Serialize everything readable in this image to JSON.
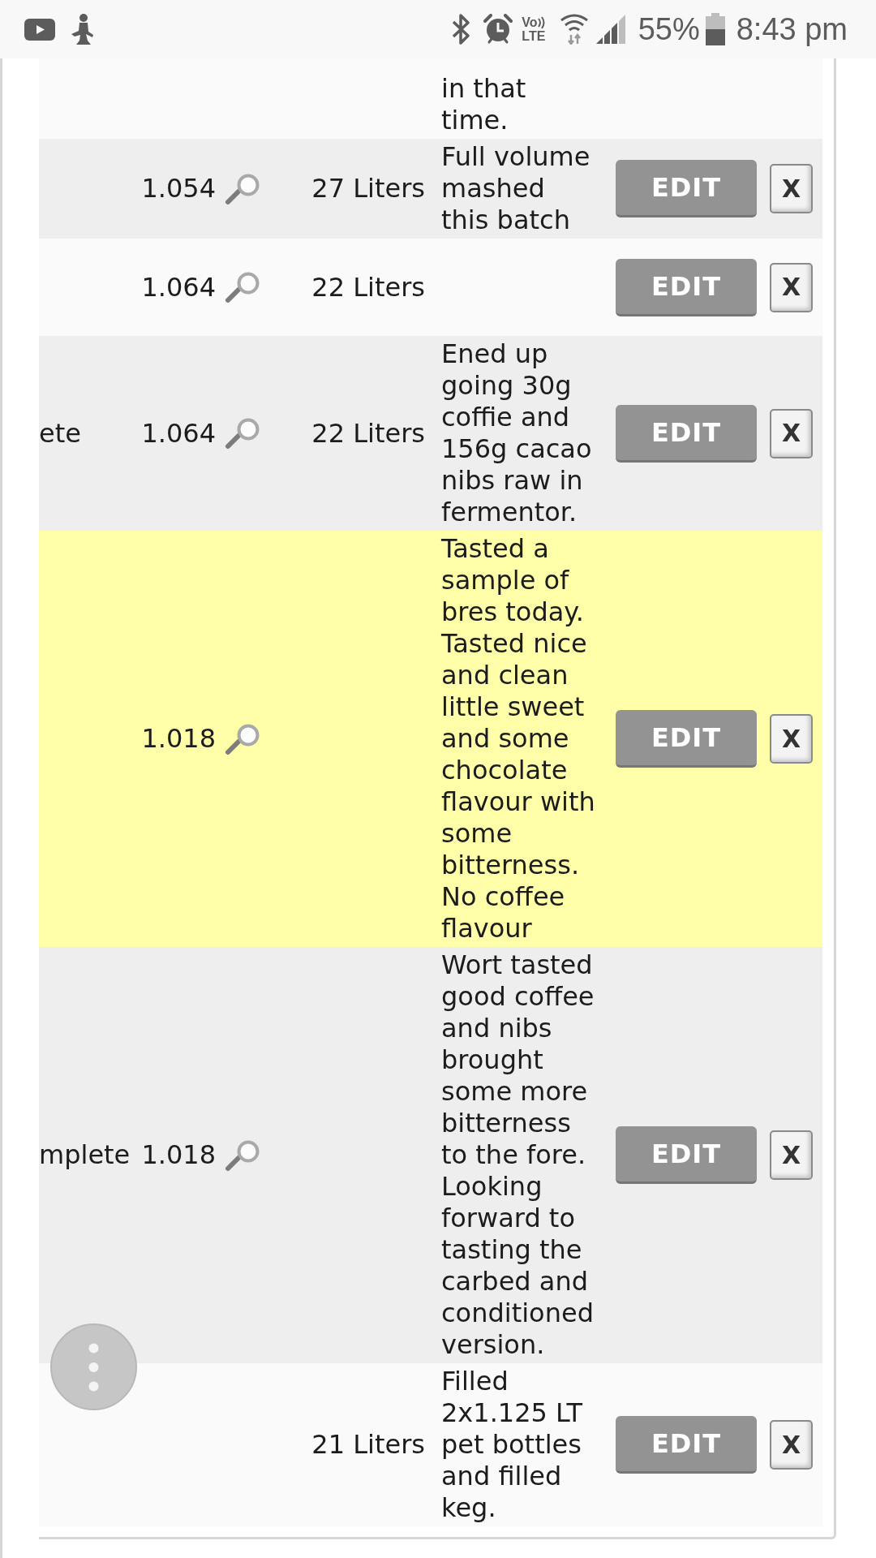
{
  "status_bar": {
    "volte_top": "Vo",
    "volte_bottom": "LTE",
    "battery_percent": "55%",
    "time": "8:43 pm"
  },
  "table": {
    "rows": [
      {
        "column_4": "in that\ntime.",
        "highlighted": false
      },
      {
        "column_2": "1.054",
        "column_3": "27 Liters",
        "column_4": "Full volume\nmashed\nthis batch",
        "edit_button": "EDIT",
        "delete_button": "X",
        "highlighted": false
      },
      {
        "column_2": "1.064",
        "column_3": "22 Liters",
        "edit_button": "EDIT",
        "delete_button": "X",
        "highlighted": false
      },
      {
        "column_1": "ete",
        "column_2": "1.064",
        "column_3": "22 Liters",
        "column_4": "Ened up\ngoing 30g\ncoffie and\n156g cacao\nnibs raw in\nfermentor.",
        "edit_button": "EDIT",
        "delete_button": "X",
        "highlighted": false
      },
      {
        "column_2": "1.018",
        "column_4": "Tasted a\nsample of\nbres today.\nTasted nice\nand clean\nlittle sweet\nand some\nchocolate\nflavour with\nsome\nbitterness.\nNo coffee\nflavour",
        "edit_button": "EDIT",
        "delete_button": "X",
        "highlighted": true
      },
      {
        "column_1": "mplete",
        "column_2": "1.018",
        "column_4": "Wort tasted\ngood coffee\nand nibs\nbrought\nsome more\nbitterness\nto the fore.\nLooking\nforward to\ntasting the\ncarbed and\nconditioned\nversion.",
        "edit_button": "EDIT",
        "delete_button": "X",
        "highlighted": false
      },
      {
        "column_3": "21 Liters",
        "column_4": "Filled\n2x1.125 LT\npet bottles\nand filled\nkeg.",
        "edit_button": "EDIT",
        "delete_button": "X",
        "highlighted": false
      }
    ]
  }
}
